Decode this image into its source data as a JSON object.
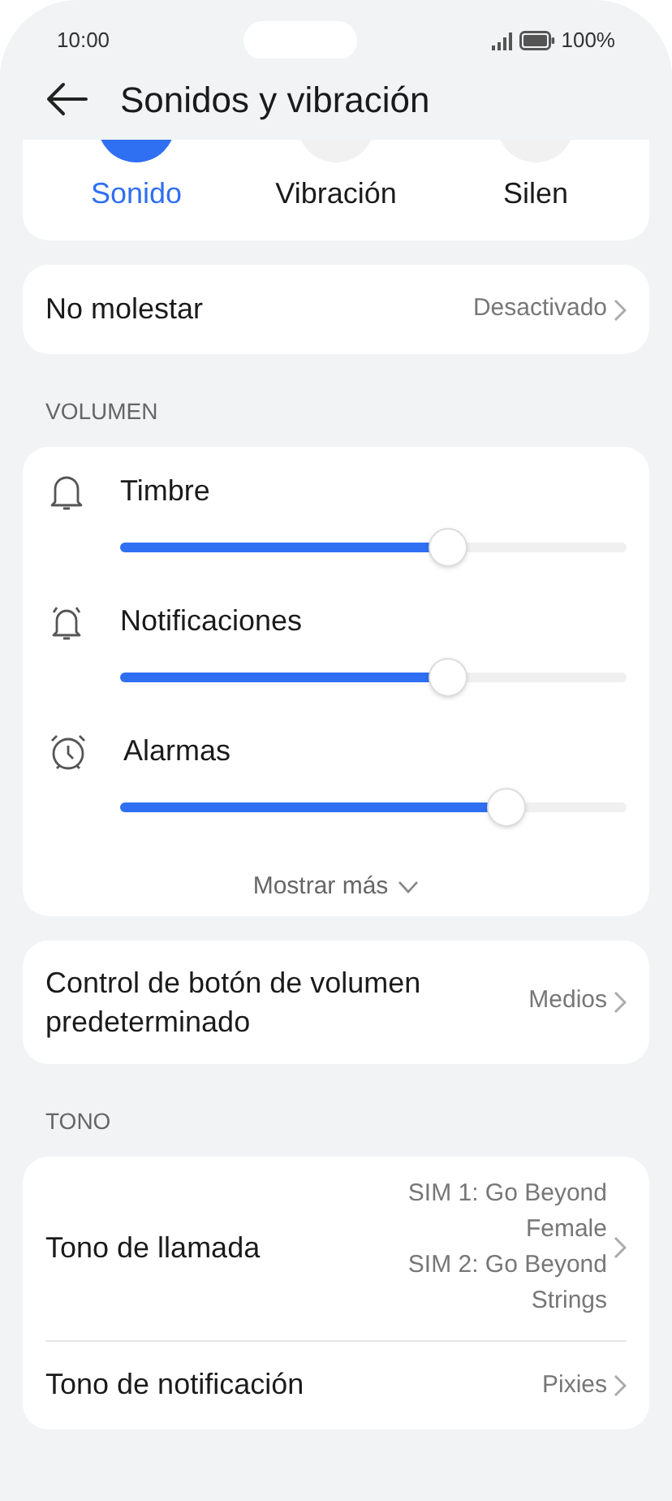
{
  "status_bar": {
    "time": "10:00",
    "battery": "100%"
  },
  "header": {
    "title": "Sonidos y vibración"
  },
  "modes": [
    {
      "label": "Sonido",
      "selected": true
    },
    {
      "label": "Vibración",
      "selected": false
    },
    {
      "label": "Silen",
      "selected": false
    }
  ],
  "do_not_disturb": {
    "label": "No molestar",
    "value": "Desactivado"
  },
  "volume": {
    "heading": "VOLUMEN",
    "sliders": [
      {
        "kind": "bell",
        "label": "Timbre",
        "level": 0.66
      },
      {
        "kind": "ringing-bell",
        "label": "Notificaciones",
        "level": 0.66
      },
      {
        "kind": "alarm",
        "label": "Alarmas",
        "level": 0.785
      }
    ],
    "show_more": "Mostrar más"
  },
  "volume_button": {
    "label": "Control de botón de volumen predeterminado",
    "value": "Medios"
  },
  "tone": {
    "heading": "TONO",
    "rows": [
      {
        "label": "Tono de llamada",
        "values": [
          "SIM 1: Go Beyond Female",
          "SIM 2: Go Beyond Strings"
        ]
      },
      {
        "label": "Tono de notificación",
        "values": [
          "Pixies"
        ]
      }
    ]
  }
}
